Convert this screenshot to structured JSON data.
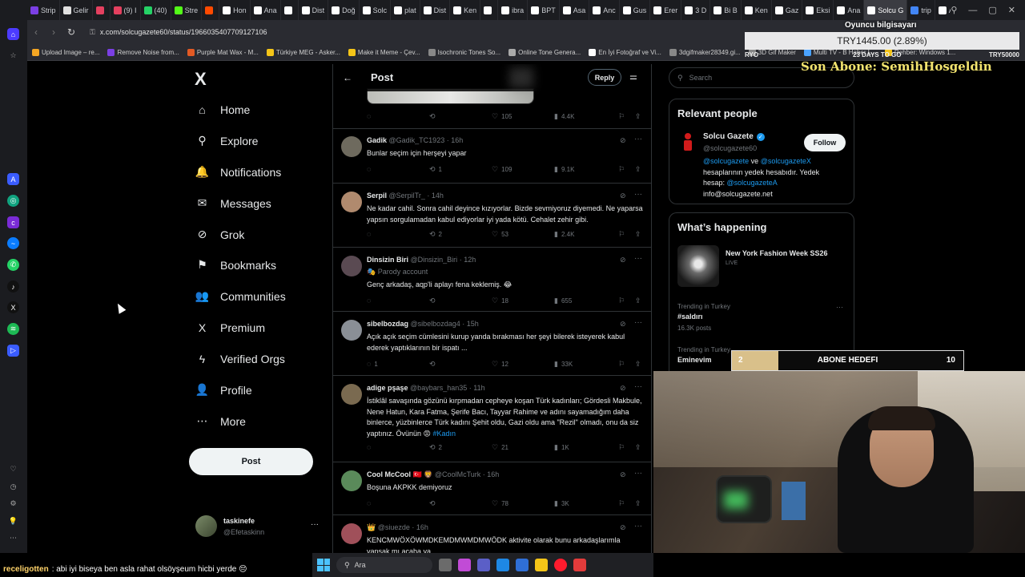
{
  "browser": {
    "tabs": [
      {
        "label": "Strip",
        "color": "#7b3fe4"
      },
      {
        "label": "Gelir",
        "color": "#e0e0e0"
      },
      {
        "label": "",
        "color": "#e4405f"
      },
      {
        "label": "(9) I",
        "color": "#e4405f"
      },
      {
        "label": "(40)",
        "color": "#25d366"
      },
      {
        "label": "Stre",
        "color": "#53fc18"
      },
      {
        "label": "",
        "color": "#ff4a00"
      },
      {
        "label": "Hon",
        "color": "#ffffff"
      },
      {
        "label": "Ana",
        "color": "#ffffff"
      },
      {
        "label": "",
        "color": "#ffffff"
      },
      {
        "label": "Dist",
        "color": "#ffffff"
      },
      {
        "label": "Doğ",
        "color": "#ffffff"
      },
      {
        "label": "Solc",
        "color": "#ffffff"
      },
      {
        "label": "plat",
        "color": "#ffffff"
      },
      {
        "label": "Dist",
        "color": "#ffffff"
      },
      {
        "label": "Ken",
        "color": "#ffffff"
      },
      {
        "label": "",
        "color": "#ffffff"
      },
      {
        "label": "ibra",
        "color": "#ffffff"
      },
      {
        "label": "BPT",
        "color": "#ffffff"
      },
      {
        "label": "Asa",
        "color": "#ffffff"
      },
      {
        "label": "Anc",
        "color": "#ffffff"
      },
      {
        "label": "Gus",
        "color": "#ffffff"
      },
      {
        "label": "Erer",
        "color": "#ffffff"
      },
      {
        "label": "3 D",
        "color": "#ffffff"
      },
      {
        "label": "Bi B",
        "color": "#ffffff"
      },
      {
        "label": "Ken",
        "color": "#ffffff"
      },
      {
        "label": "Gaz",
        "color": "#ffffff"
      },
      {
        "label": "Eksi",
        "color": "#ffffff"
      },
      {
        "label": "Ana",
        "color": "#ffffff"
      },
      {
        "label": "Solcu G",
        "color": "#ffffff",
        "active": true
      },
      {
        "label": "trip",
        "color": "#4285f4"
      },
      {
        "label": "A S",
        "color": "#ffffff"
      },
      {
        "label": "CEM",
        "color": "#ff0000"
      }
    ],
    "url": "x.com/solcugazete60/status/1966035407709127106",
    "bookmarks": [
      {
        "label": "Upload Image – re...",
        "color": "#f5a623"
      },
      {
        "label": "Remove Noise from...",
        "color": "#7b3fe4"
      },
      {
        "label": "Purple Mat Wax - M...",
        "color": "#e35a24"
      },
      {
        "label": "Türkiye MEG - Asker...",
        "color": "#f5c518"
      },
      {
        "label": "Make it Meme - Çev...",
        "color": "#f5c518"
      },
      {
        "label": "Isochronic Tones So...",
        "color": "#888888"
      },
      {
        "label": "Online Tone Genera...",
        "color": "#aaaaaa"
      },
      {
        "label": "En İyi Fotoğraf ve Vi...",
        "color": "#ffffff"
      },
      {
        "label": "3dgifmaker28349.gi...",
        "color": "#888888"
      },
      {
        "label": "3D Gif Maker",
        "color": "#888888"
      },
      {
        "label": "Multi TV - B Haber L...",
        "color": "#4aa3ff"
      },
      {
        "label": "Rehber: Windows 1...",
        "color": "#f5c518"
      }
    ]
  },
  "xnav": {
    "logo": "X",
    "items": [
      {
        "label": "Home",
        "icon": "⌂",
        "name": "home"
      },
      {
        "label": "Explore",
        "icon": "⚲",
        "name": "explore"
      },
      {
        "label": "Notifications",
        "icon": "🔔",
        "name": "notifications"
      },
      {
        "label": "Messages",
        "icon": "✉",
        "name": "messages"
      },
      {
        "label": "Grok",
        "icon": "⊘",
        "name": "grok"
      },
      {
        "label": "Bookmarks",
        "icon": "⚑",
        "name": "bookmarks"
      },
      {
        "label": "Communities",
        "icon": "👥",
        "name": "communities"
      },
      {
        "label": "Premium",
        "icon": "X",
        "name": "premium"
      },
      {
        "label": "Verified Orgs",
        "icon": "ϟ",
        "name": "verified-orgs"
      },
      {
        "label": "Profile",
        "icon": "👤",
        "name": "profile"
      },
      {
        "label": "More",
        "icon": "⋯",
        "name": "more"
      }
    ],
    "post_label": "Post",
    "account": {
      "name": "taskinefe",
      "handle": "@Efetaskinn",
      "more": "···"
    }
  },
  "post_header": {
    "back": "←",
    "title": "Post",
    "reply_label": "Reply"
  },
  "top_stats": {
    "replies": "",
    "reposts": "",
    "likes": "105",
    "views": "4.4K"
  },
  "replies": [
    {
      "name": "Gadik",
      "handle": "@Gadik_TC1923",
      "time": "16h",
      "sub": "",
      "text": "Bunlar seçim için herşeyi yapar",
      "tag": "",
      "replies": "",
      "reposts": "1",
      "likes": "109",
      "views": "9.1K",
      "avatar": "#6e6a5e"
    },
    {
      "name": "Serpil",
      "handle": "@SerpilTr_",
      "time": "14h",
      "sub": "",
      "text": "Ne kadar cahil. Sonra cahil deyince kızıyorlar. Bizde sevmiyoruz diyemedi. Ne yaparsa yapsın sorgulamadan kabul ediyorlar iyi yada kötü. Cehalet zehir gibi.",
      "tag": "",
      "replies": "",
      "reposts": "2",
      "likes": "53",
      "views": "2.4K",
      "avatar": "#b08a6e"
    },
    {
      "name": "Dinsizin Biri",
      "handle": "@Dinsizin_Biri",
      "time": "12h",
      "sub": "Parody account",
      "text": "Genç arkadaş, aqp'li aplayı fena keklemiş. 😂",
      "tag": "",
      "replies": "",
      "reposts": "",
      "likes": "18",
      "views": "655",
      "avatar": "#5a4a52"
    },
    {
      "name": "sibelbozdag",
      "handle": "@sibelbozdag4",
      "time": "15h",
      "sub": "",
      "text": "Açık açık seçim cümlesini kurup yanda bırakması her şeyi bilerek isteyerek kabul ederek yaptıklarının bir ispatı ...",
      "tag": "",
      "replies": "1",
      "reposts": "",
      "likes": "12",
      "views": "33K",
      "avatar": "#8a8f96"
    },
    {
      "name": "adige pşaşe",
      "handle": "@baybars_han35",
      "time": "11h",
      "sub": "",
      "text": "İstiklâl savaşında gözünü kırpmadan cepheye koşan Türk kadınları; Gördesli Makbule, Nene Hatun, Kara Fatma, Şerife Bacı, Tayyar Rahime ve adını sayamadığım daha binlerce, yüzbinlerce Türk kadını Şehit oldu, Gazi oldu ama \"Rezil\" olmadı, onu da siz yaptınız. Övünün 😡",
      "tag": "#Kadın",
      "replies": "",
      "reposts": "2",
      "likes": "21",
      "views": "1K",
      "avatar": "#7a6a50"
    },
    {
      "name": "Cool McCool 🇹🇷 🦁",
      "handle": "@CoolMcTurk",
      "time": "16h",
      "sub": "",
      "text": "Boşuna AKPKK demiyoruz",
      "tag": "",
      "replies": "",
      "reposts": "",
      "likes": "78",
      "views": "3K",
      "avatar": "#5a8a5a"
    },
    {
      "name": "👑",
      "handle": "@siuezde",
      "time": "16h",
      "sub": "",
      "text": "KENCMWÖXÖWMDKEMDMWMDMWÖDK aktivite olarak bunu arkadaşlarımla yapsak mı acaba ya",
      "tag": "",
      "replies": "",
      "reposts": "",
      "likes": "",
      "views": "",
      "avatar": "#a0505a"
    }
  ],
  "right": {
    "search_placeholder": "Search",
    "relevant_title": "Relevant people",
    "rp_name": "Solcu Gazete",
    "rp_handle": "@solcugazete60",
    "follow_label": "Follow",
    "rp_bio_1a": "@solcugazete",
    "rp_bio_1b": " ve ",
    "rp_bio_1c": "@solcugazeteX",
    "rp_bio_2": "hesaplarının yedek hesabıdır. Yedek",
    "rp_bio_3a": "hesap: ",
    "rp_bio_3b": "@solcugazeteA",
    "rp_bio_4": "info@solcugazete.net",
    "happening_title": "What’s happening",
    "live_title": "New York Fashion Week SS26",
    "live_sub": "LIVE",
    "trends": [
      {
        "context": "Trending in Turkey",
        "name": "#saldırı",
        "count": "16.3K posts"
      },
      {
        "context": "Trending in Turkey",
        "name": "Eminevim",
        "count": ""
      }
    ]
  },
  "overlay": {
    "title": "Oyuncu bilgisayarı",
    "price": "TRY1445.00 (2.89%)",
    "left_label": "RYO",
    "mid_label": "23 DAYS TO GO",
    "right_label": "TRY50000",
    "son_abone": "Son Abone: SemihHosgeldin",
    "goal_current": "2",
    "goal_label": "ABONE HEDEFI",
    "goal_max": "10",
    "goal_progress": 0.2
  },
  "chat": {
    "user": "receligotten",
    "message": ": abi iyi biseya ben asla rahat olsöyşeum hicbi yerde 😔"
  },
  "taskbar": {
    "search_label": "Ara"
  }
}
